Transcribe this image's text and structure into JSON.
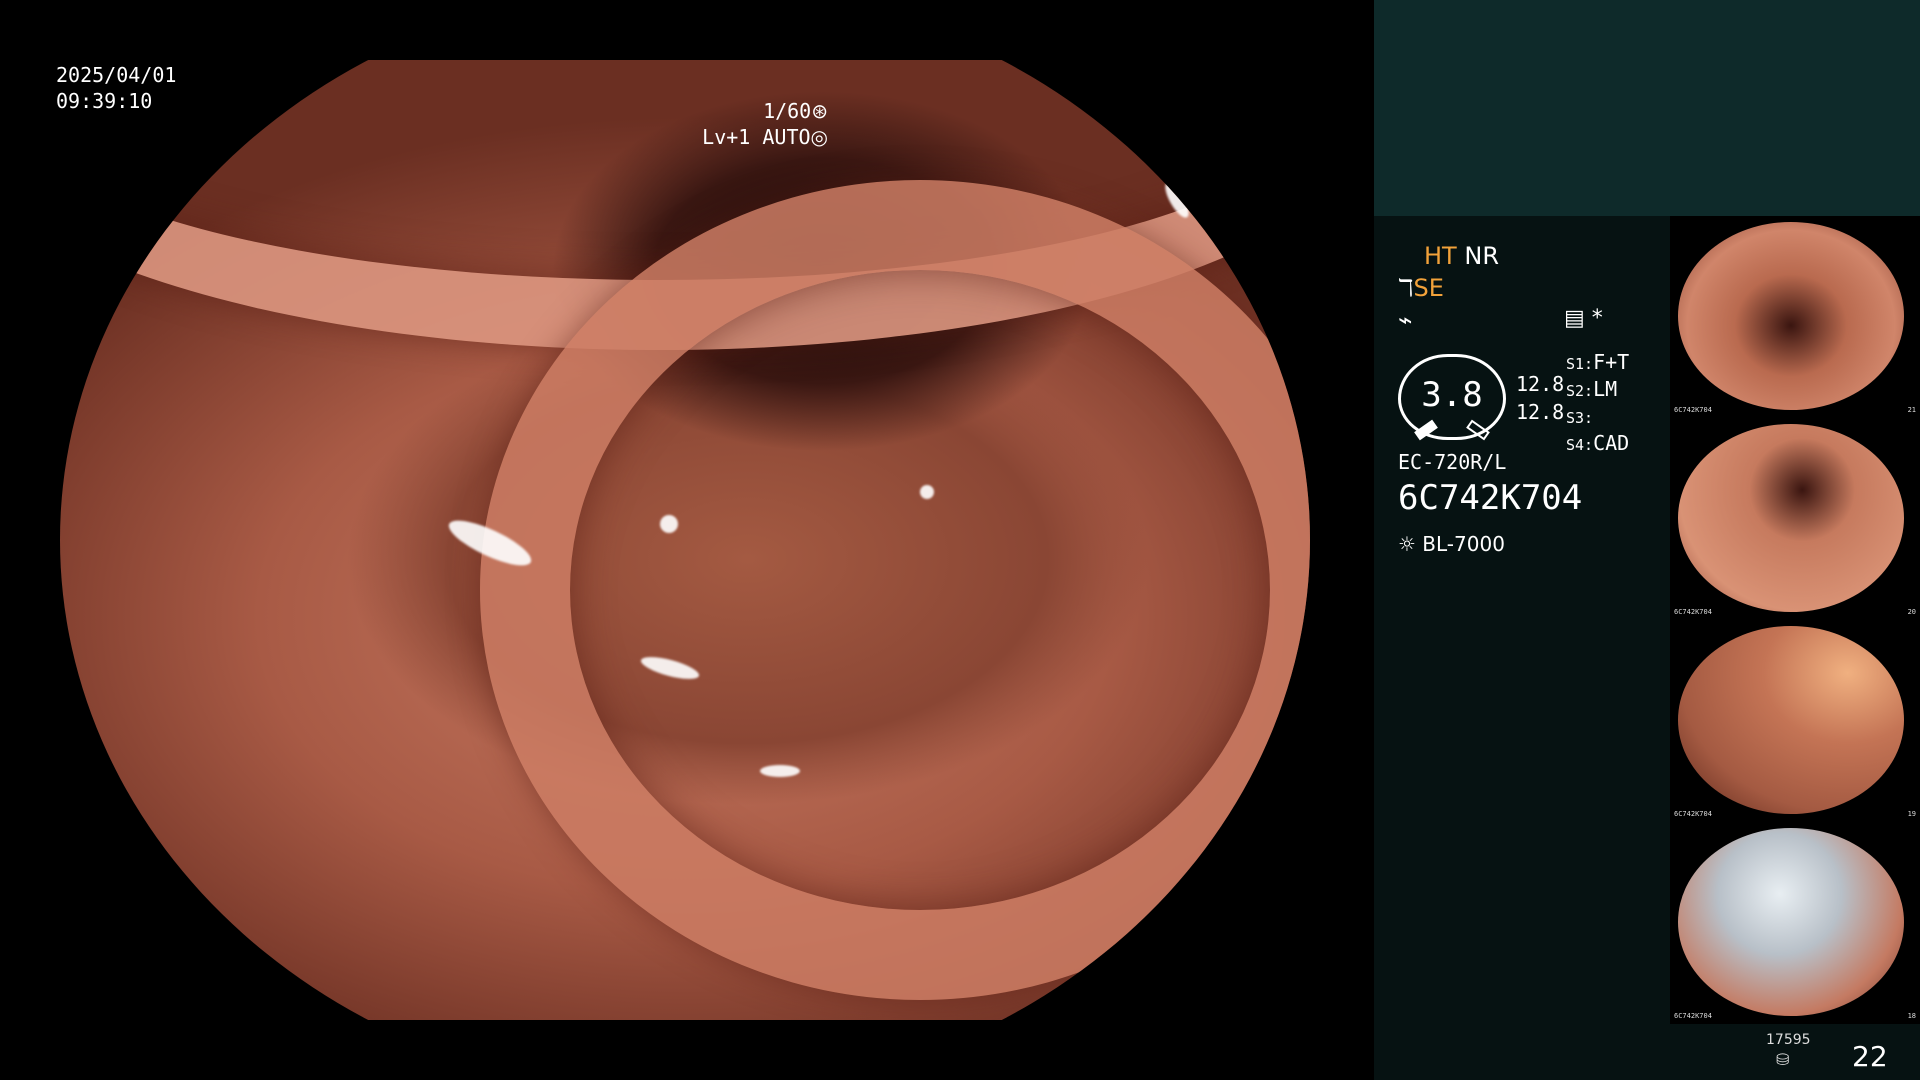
{
  "osd": {
    "date": "2025/04/01",
    "time": "09:39:10",
    "shutter": "1/60",
    "shutter_icon": "aperture-icon",
    "level": "Lv+1",
    "iris": "AUTO",
    "iris_icon": "iris-icon"
  },
  "panel": {
    "mode_ht": "HT",
    "mode_nr": "NR",
    "mode_se": "SE",
    "se_icon": "scope-angle-icon",
    "flash_icon": "lightning-icon",
    "settings_icon": "sliders-icon",
    "star": "*",
    "gauge_value": "3.8",
    "gauge_side_1": "12.8",
    "gauge_side_2": "12.8",
    "settings": [
      {
        "key": "S1:",
        "value": "F+T"
      },
      {
        "key": "S2:",
        "value": "LM"
      },
      {
        "key": "S3:",
        "value": ""
      },
      {
        "key": "S4:",
        "value": "CAD"
      }
    ],
    "model": "EC-720R/L",
    "serial": "6C742K704",
    "light_source": "BL-7000",
    "light_icon": "sun-icon",
    "accent_color": "#f2a23a"
  },
  "thumbnails": [
    {
      "caption": "6C742K704",
      "index": "21"
    },
    {
      "caption": "6C742K704",
      "index": "20"
    },
    {
      "caption": "6C742K704",
      "index": "19"
    },
    {
      "caption": "6C742K704",
      "index": "18"
    }
  ],
  "footer": {
    "frame_count": "17595",
    "storage_icon": "database-icon",
    "page_number": "22"
  }
}
